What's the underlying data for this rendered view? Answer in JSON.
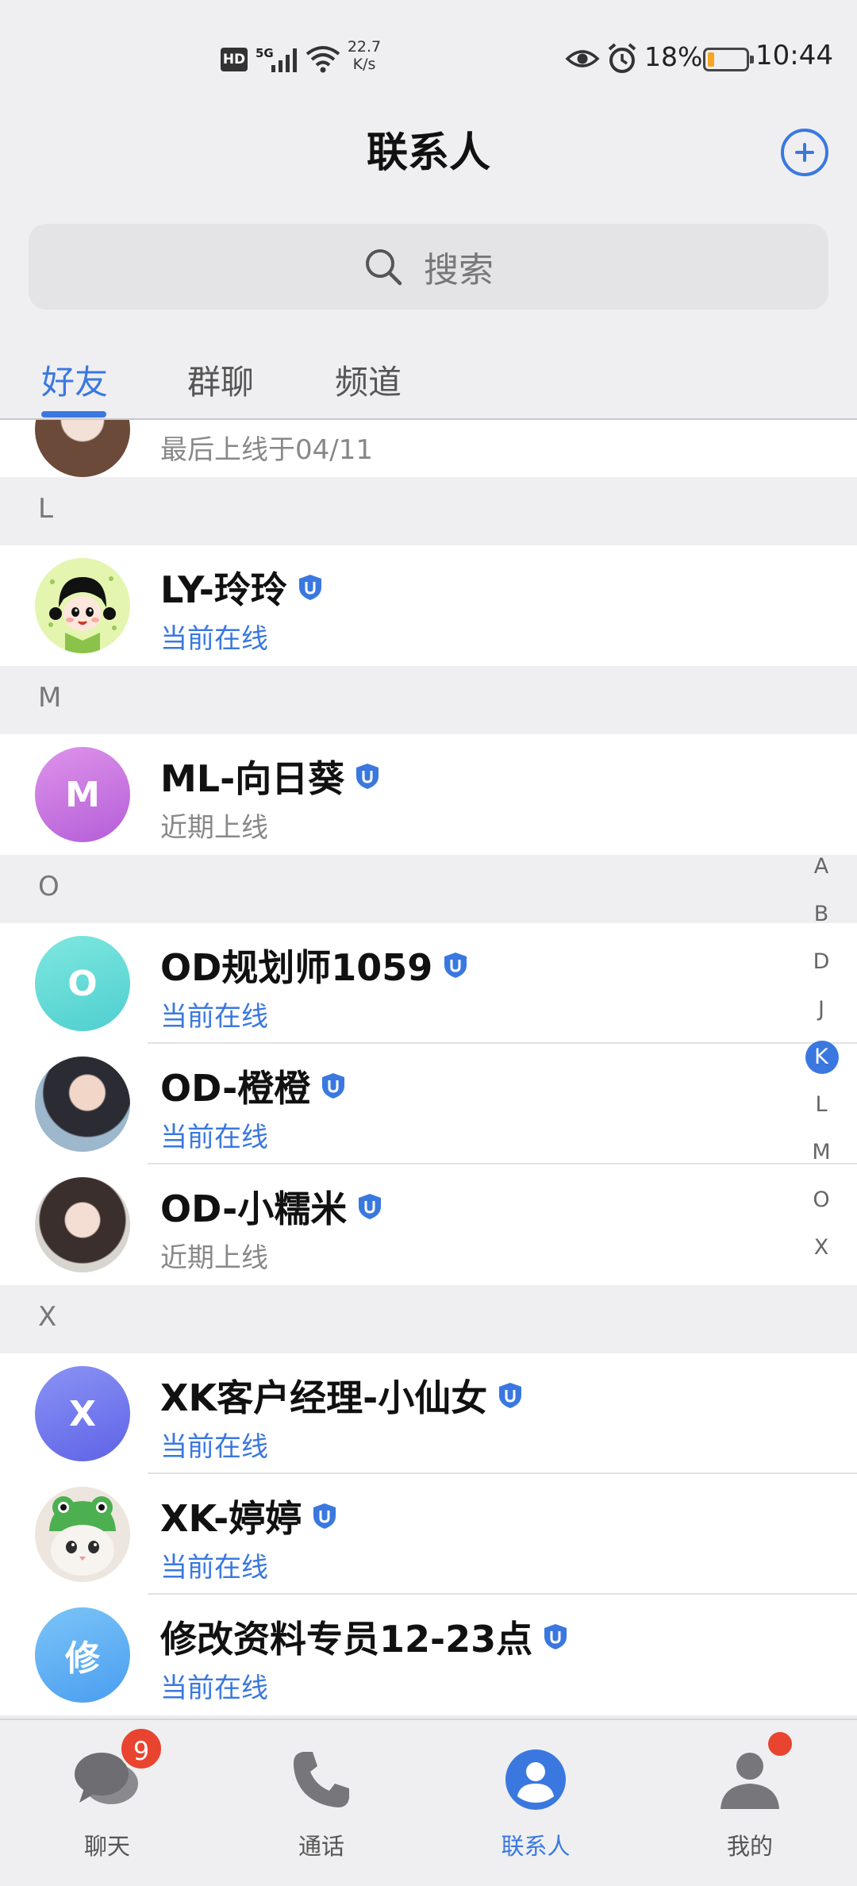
{
  "status_bar": {
    "hd": "HD",
    "network": "5G",
    "speed_value": "22.7",
    "speed_unit": "K/s",
    "battery": "18%",
    "time": "10:44",
    "icons": [
      "signal-icon",
      "wifi-icon",
      "eye-icon",
      "alarm-icon",
      "battery-icon"
    ],
    "battery_level_fraction": 0.18
  },
  "header": {
    "title": "联系人",
    "add_icon": "plus-circle-icon"
  },
  "search": {
    "placeholder": "搜索",
    "icon": "search-icon"
  },
  "tabs": [
    {
      "label": "好友",
      "active": true
    },
    {
      "label": "群聊",
      "active": false
    },
    {
      "label": "频道",
      "active": false
    }
  ],
  "partial_row": {
    "status": "最后上线于04/11"
  },
  "sections": {
    "L": "L",
    "M": "M",
    "O": "O",
    "X": "X"
  },
  "contacts": [
    {
      "name": "LY-玲玲",
      "status": "当前在线",
      "avatar": "cartoon-girl"
    },
    {
      "name": "ML-向日葵",
      "status": "近期上线",
      "avatar_letter": "M"
    },
    {
      "name": "OD规划师1059",
      "status": "当前在线",
      "avatar_letter": "O"
    },
    {
      "name": "OD-橙橙",
      "status": "当前在线",
      "avatar": "photo"
    },
    {
      "name": "OD-小糯米",
      "status": "近期上线",
      "avatar": "photo"
    },
    {
      "name": "XK客户经理-小仙女",
      "status": "当前在线",
      "avatar_letter": "X"
    },
    {
      "name": "XK-婷婷",
      "status": "当前在线",
      "avatar": "cat-frog-hat"
    },
    {
      "name": "修改资料专员12-23点",
      "status": "当前在线",
      "avatar_letter": "修"
    }
  ],
  "alphabet_index": [
    "A",
    "B",
    "D",
    "J",
    "K",
    "L",
    "M",
    "O",
    "X"
  ],
  "alphabet_active": "K",
  "bottom_nav": [
    {
      "label": "聊天",
      "icon": "chat-icon",
      "badge": "9"
    },
    {
      "label": "通话",
      "icon": "phone-icon"
    },
    {
      "label": "联系人",
      "icon": "contacts-icon",
      "active": true
    },
    {
      "label": "我的",
      "icon": "profile-icon",
      "dot": true
    }
  ],
  "colors": {
    "accent": "#3a78e0",
    "badge": "#e8442f",
    "background": "#efeff1",
    "online": "#3a78e0",
    "offline": "#888888"
  }
}
